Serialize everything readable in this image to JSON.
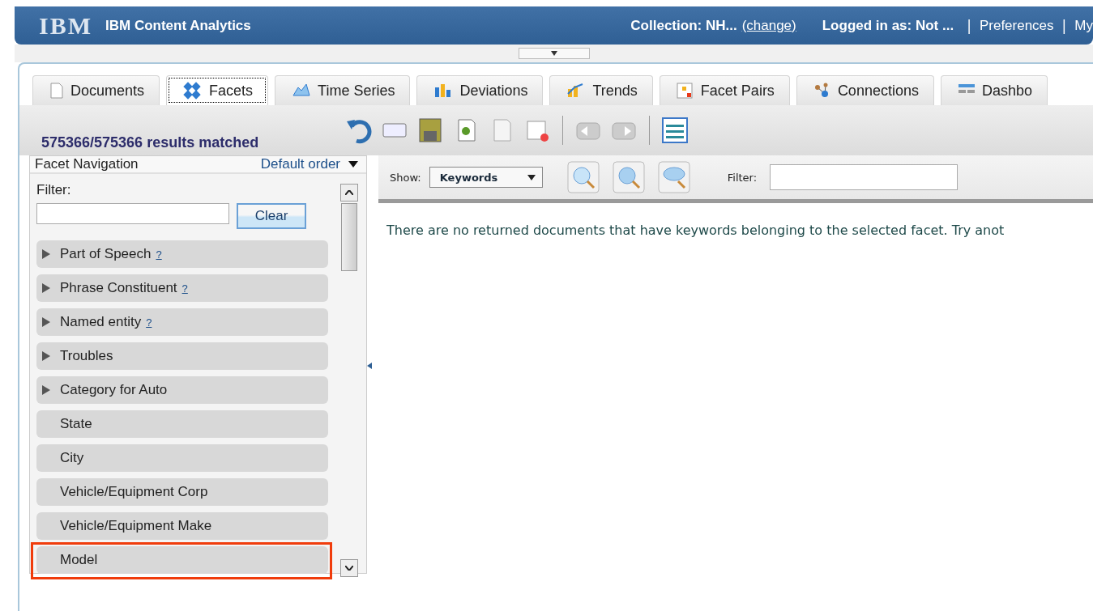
{
  "header": {
    "logo": "IBM",
    "title": "IBM Content Analytics",
    "collection": "Collection: NH...",
    "change_link": "(change)",
    "login": "Logged in as: Not ...",
    "links": [
      {
        "separator": "|",
        "label": "Preferences"
      },
      {
        "separator": "|",
        "label": "My"
      }
    ]
  },
  "tabs": [
    {
      "label": "Documents",
      "selected": false
    },
    {
      "label": "Facets",
      "selected": true
    },
    {
      "label": "Time Series",
      "selected": false
    },
    {
      "label": "Deviations",
      "selected": false
    },
    {
      "label": "Trends",
      "selected": false
    },
    {
      "label": "Facet Pairs",
      "selected": false
    },
    {
      "label": "Connections",
      "selected": false
    },
    {
      "label": "Dashbo",
      "selected": false
    }
  ],
  "results": "575366/575366 results matched",
  "facet_nav": {
    "title": "Facet Navigation",
    "order": "Default order",
    "filter_label": "Filter:",
    "clear": "Clear",
    "items": [
      {
        "label": "Part of Speech",
        "kind": "expandable",
        "help": "?",
        "highlighted": false
      },
      {
        "label": "Phrase Constituent",
        "kind": "expandable",
        "help": "?",
        "highlighted": false
      },
      {
        "label": "Named entity",
        "kind": "expandable",
        "help": "?",
        "highlighted": false
      },
      {
        "label": "Troubles",
        "kind": "expandable",
        "highlighted": false
      },
      {
        "label": "Category for Auto",
        "kind": "expandable",
        "highlighted": false
      },
      {
        "label": "State",
        "kind": "plain",
        "highlighted": false
      },
      {
        "label": "City",
        "kind": "plain",
        "highlighted": false
      },
      {
        "label": "Vehicle/Equipment Corp",
        "kind": "plain",
        "highlighted": false
      },
      {
        "label": "Vehicle/Equipment Make",
        "kind": "plain",
        "highlighted": false
      },
      {
        "label": "Model",
        "kind": "plain",
        "highlighted": true
      }
    ]
  },
  "results_panel": {
    "show_label": "Show:",
    "show_value": "Keywords",
    "filter_label": "Filter:",
    "message": "There are no returned documents that have keywords belonging to the selected facet. Try anot"
  }
}
